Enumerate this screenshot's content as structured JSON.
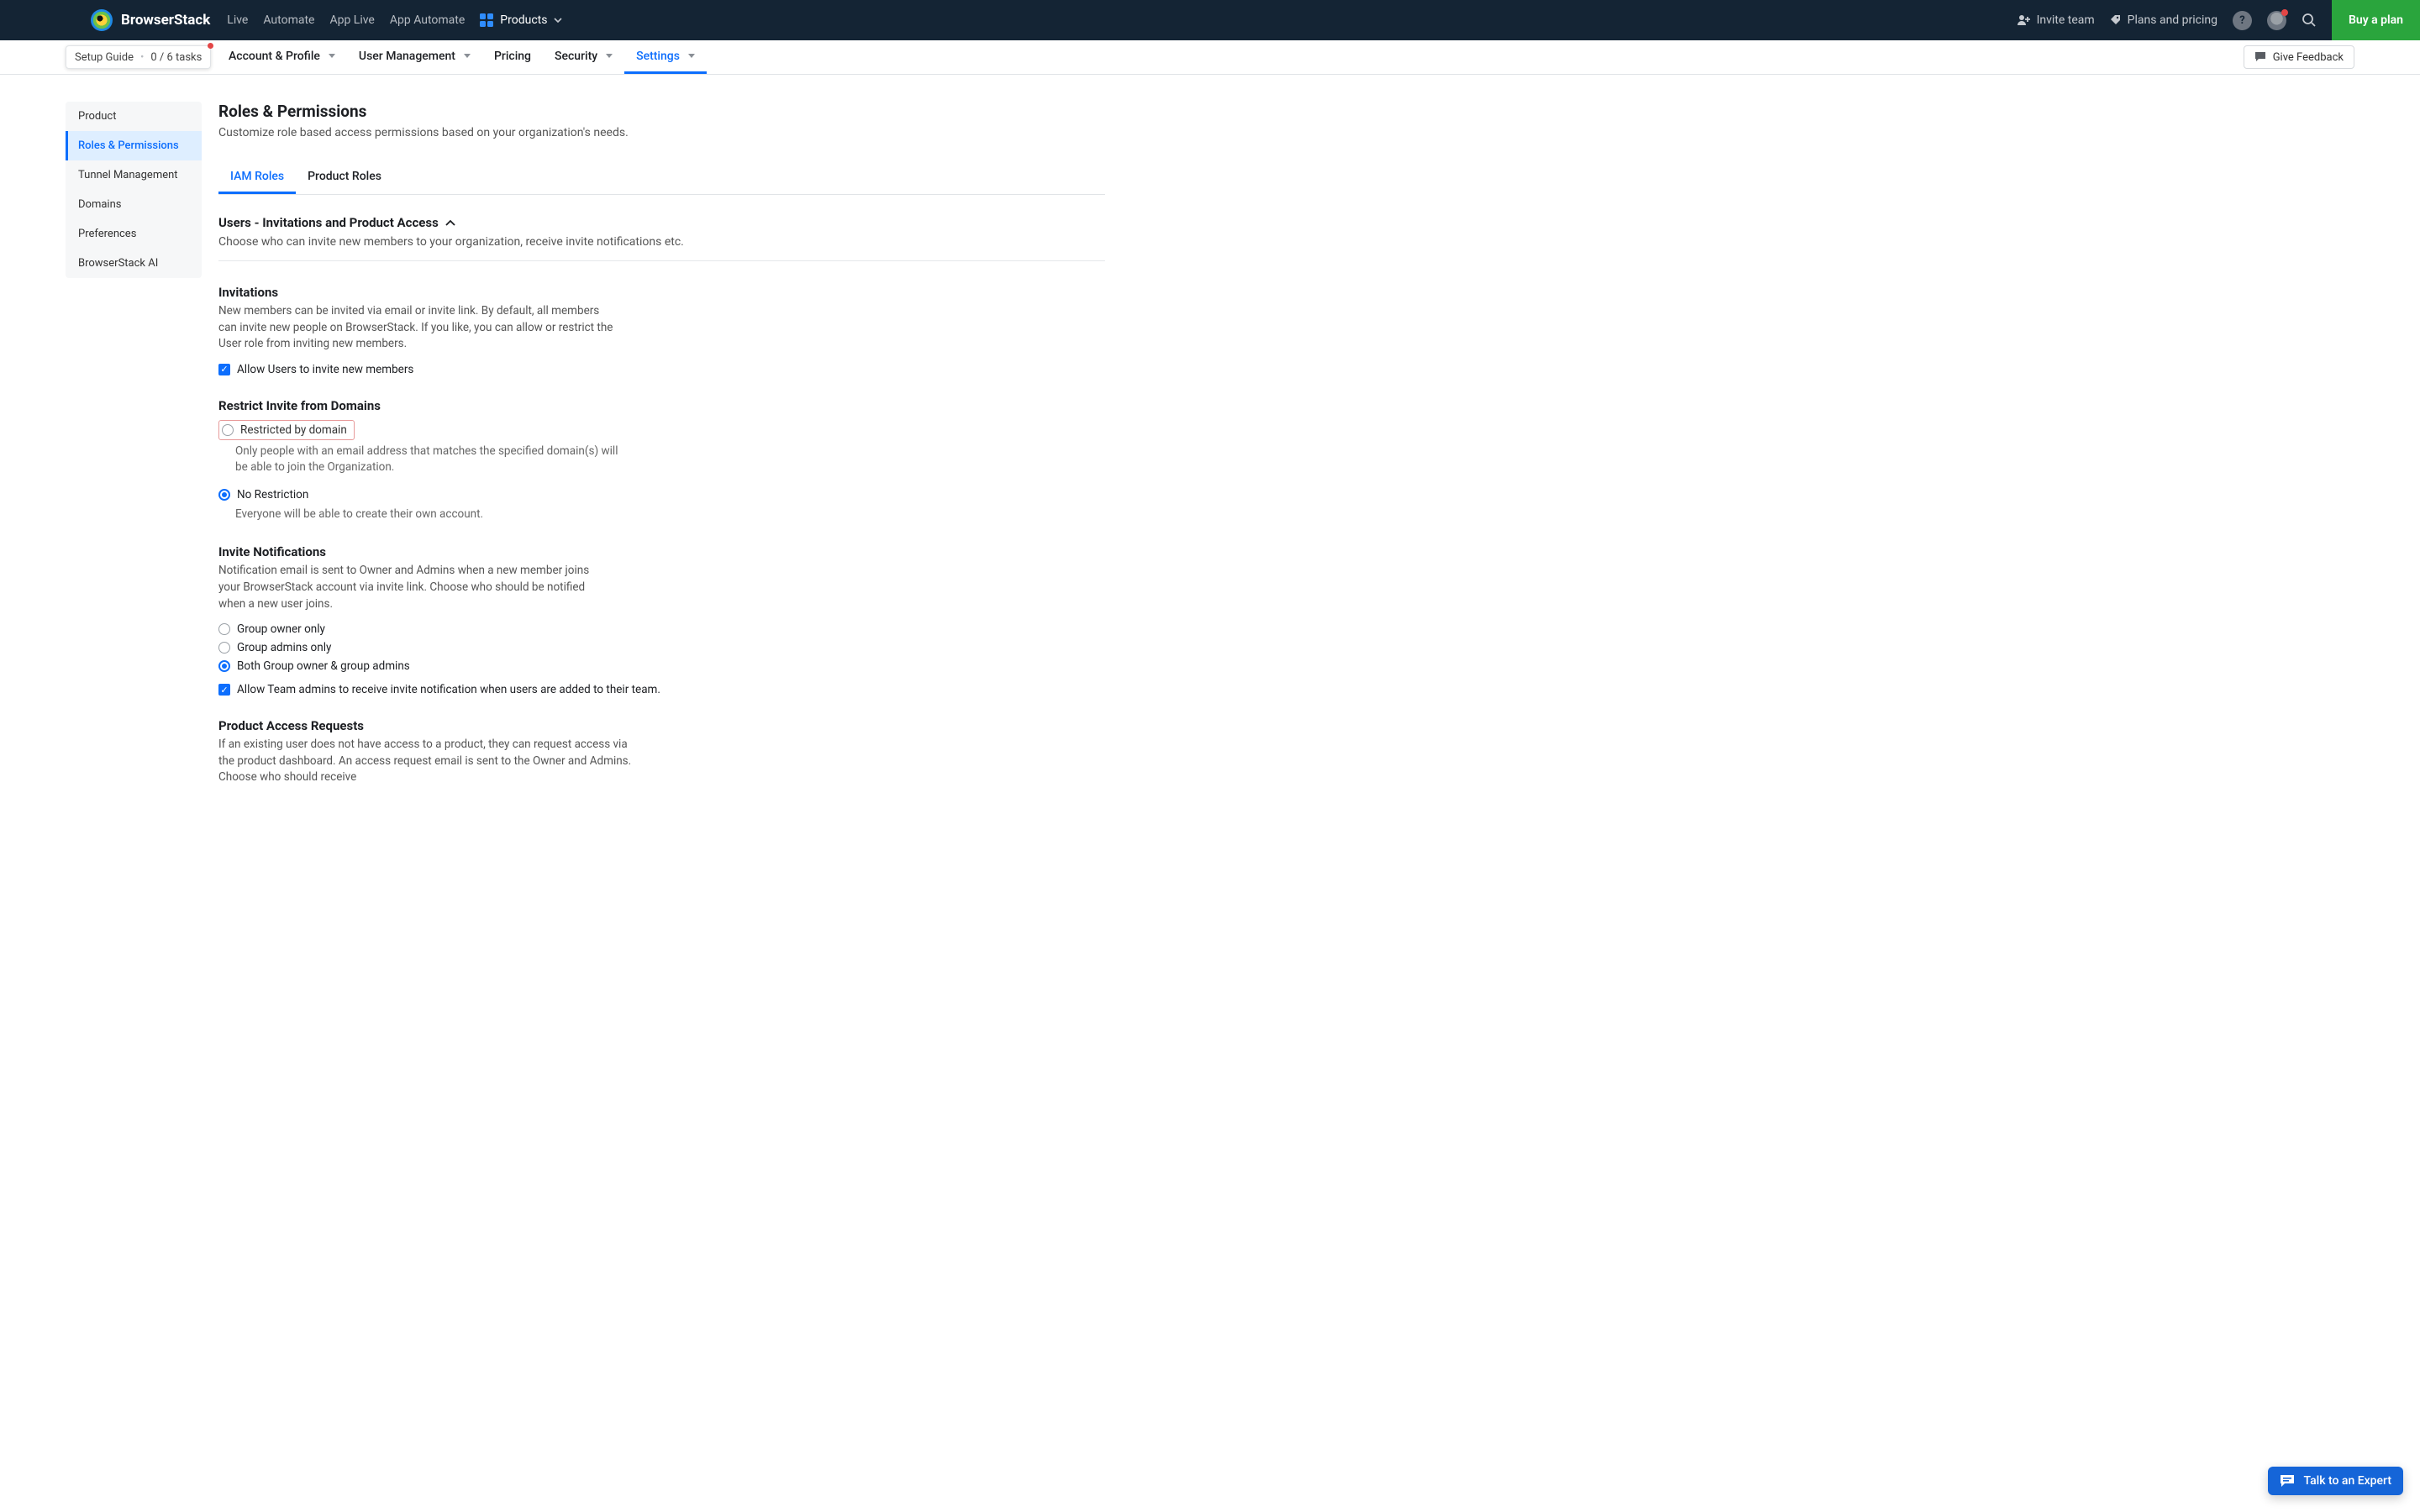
{
  "topnav": {
    "brand": "BrowserStack",
    "links": [
      "Live",
      "Automate",
      "App Live",
      "App Automate"
    ],
    "products_label": "Products",
    "invite_team": "Invite team",
    "plans_pricing": "Plans and pricing",
    "buy_plan": "Buy a plan"
  },
  "setup_guide": {
    "label": "Setup Guide",
    "progress": "0 / 6 tasks"
  },
  "sectabs": [
    {
      "label": "Account & Profile",
      "chev": true,
      "active": false
    },
    {
      "label": "User Management",
      "chev": true,
      "active": false
    },
    {
      "label": "Pricing",
      "chev": false,
      "active": false
    },
    {
      "label": "Security",
      "chev": true,
      "active": false
    },
    {
      "label": "Settings",
      "chev": true,
      "active": true
    }
  ],
  "give_feedback": "Give Feedback",
  "sidebar": {
    "items": [
      {
        "label": "Product",
        "active": false
      },
      {
        "label": "Roles & Permissions",
        "active": true
      },
      {
        "label": "Tunnel Management",
        "active": false
      },
      {
        "label": "Domains",
        "active": false
      },
      {
        "label": "Preferences",
        "active": false
      },
      {
        "label": "BrowserStack AI",
        "active": false
      }
    ]
  },
  "page": {
    "title": "Roles & Permissions",
    "subtitle": "Customize role based access permissions based on your organization's needs."
  },
  "subtabs": [
    {
      "label": "IAM Roles",
      "active": true
    },
    {
      "label": "Product Roles",
      "active": false
    }
  ],
  "accordion": {
    "title": "Users - Invitations and Product Access",
    "desc": "Choose who can invite new members to your organization, receive invite notifications etc."
  },
  "invitations": {
    "title": "Invitations",
    "desc": "New members can be invited via email or invite link. By default, all members can invite new people on BrowserStack. If you like, you can allow or restrict the User role from inviting new members.",
    "checkbox": "Allow Users to invite new members"
  },
  "restrict": {
    "title": "Restrict Invite from Domains",
    "opt1_label": "Restricted by domain",
    "opt1_desc": "Only people with an email address that matches the specified domain(s) will be able to join the Organization.",
    "opt2_label": "No Restriction",
    "opt2_desc": "Everyone will be able to create their own account."
  },
  "notifications": {
    "title": "Invite Notifications",
    "desc": "Notification email is sent to Owner and Admins when a new member joins your BrowserStack account via invite link. Choose who should be notified when a new user joins.",
    "opt1": "Group owner only",
    "opt2": "Group admins only",
    "opt3": "Both Group owner & group admins",
    "team_admin_cb": "Allow Team admins to receive invite notification when users are added to their team."
  },
  "par": {
    "title": "Product Access Requests",
    "desc": "If an existing user does not have access to a product, they can request access via the product dashboard. An access request email is sent to the Owner and Admins. Choose who should receive"
  },
  "chat": {
    "label": "Talk to an Expert"
  }
}
